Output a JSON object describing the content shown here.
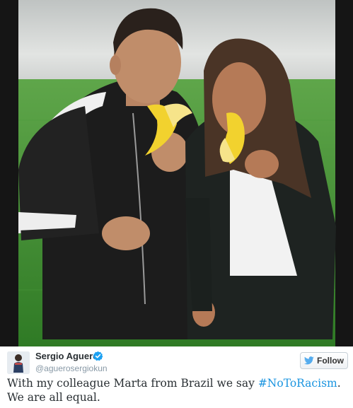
{
  "photo": {
    "alt_colors": {
      "wall": "#d9dcdc",
      "turf": "#3f8f2f",
      "banana": "#f2d22e"
    }
  },
  "author": {
    "name": "Sergio Aguero",
    "handle": "@aguerosergiokun",
    "verified": true,
    "avatar_icon": "person-avatar-icon"
  },
  "follow_button": {
    "label": "Follow",
    "icon": "twitter-bird-icon"
  },
  "tweet": {
    "text_before": "With my colleague Marta from Brazil we say ",
    "hashtag": "#NoToRacism",
    "text_after": ". We are all equal."
  },
  "colors": {
    "hashtag": "#1b95e0",
    "verified": "#1da1f2",
    "handle": "#8899a6"
  }
}
